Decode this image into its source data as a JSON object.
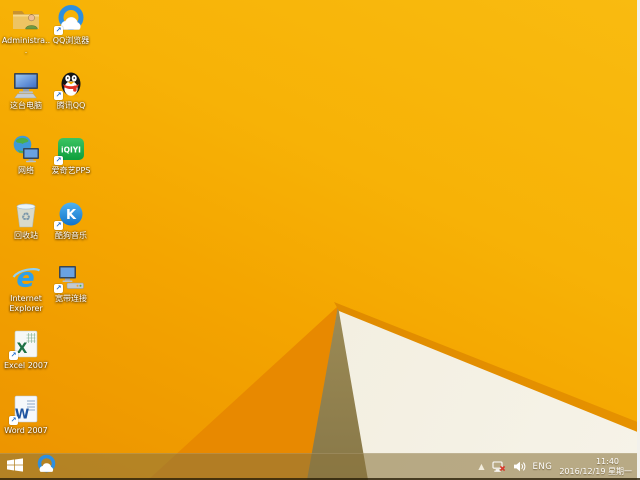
{
  "desktop": {
    "icons": [
      {
        "id": "administrator",
        "label": "Administra...",
        "col": 1,
        "row": 1,
        "shortcut": false
      },
      {
        "id": "qq-browser",
        "label": "QQ浏览器",
        "col": 2,
        "row": 1,
        "shortcut": true
      },
      {
        "id": "this-pc",
        "label": "这台电脑",
        "col": 1,
        "row": 2,
        "shortcut": false
      },
      {
        "id": "tencent-qq",
        "label": "腾讯QQ",
        "col": 2,
        "row": 2,
        "shortcut": true
      },
      {
        "id": "network",
        "label": "网络",
        "col": 1,
        "row": 3,
        "shortcut": false
      },
      {
        "id": "iqiyi-pps",
        "label": "爱奇艺PPS",
        "col": 2,
        "row": 3,
        "shortcut": true
      },
      {
        "id": "recycle-bin",
        "label": "回收站",
        "col": 1,
        "row": 4,
        "shortcut": false
      },
      {
        "id": "kugou-music",
        "label": "酷狗音乐",
        "col": 2,
        "row": 4,
        "shortcut": true
      },
      {
        "id": "internet-explorer",
        "label": "Internet Explorer",
        "col": 1,
        "row": 5,
        "shortcut": false
      },
      {
        "id": "broadband",
        "label": "宽带连接",
        "col": 2,
        "row": 5,
        "shortcut": true
      },
      {
        "id": "excel-2007",
        "label": "Excel 2007",
        "col": 1,
        "row": 6,
        "shortcut": true
      },
      {
        "id": "word-2007",
        "label": "Word 2007",
        "col": 1,
        "row": 7,
        "shortcut": true
      }
    ]
  },
  "taskbar": {
    "pinned": [
      {
        "id": "qq-browser",
        "name": "QQ浏览器"
      }
    ],
    "tray": {
      "language": "ENG",
      "time": "11:40",
      "date": "2016/12/19 星期一"
    }
  },
  "colors": {
    "wallpaper_amber": "#F7B206",
    "wallpaper_deep_orange": "#E88900",
    "wallpaper_tan": "#A6945C",
    "wallpaper_cream": "#F2EEDF",
    "taskbar_tint": "#8C763A"
  }
}
